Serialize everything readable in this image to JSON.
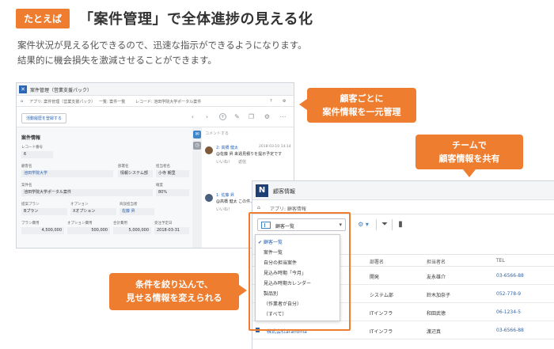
{
  "header": {
    "tag": "たとえば",
    "title": "「案件管理」で全体進捗の見える化",
    "desc_line1": "案件状況が見える化できるので、迅速な指示ができるようになります。",
    "desc_line2": "結果的に機会損失を激減させることができます。"
  },
  "callouts": {
    "c1_line1": "顧客ごとに",
    "c1_line2": "案件情報を一元管理",
    "c2_line1": "チームで",
    "c2_line2": "顧客情報を共有",
    "c3_line1": "条件を絞り込んで、",
    "c3_line2": "見せる情報を変えられる"
  },
  "shot1": {
    "app_title": "案件管理（営業支援パック）",
    "crumb_app": "アプリ: 案件管理（営業支援パック）",
    "crumb_list": "一覧: 案件一覧",
    "crumb_record": "レコード: 池田学院大学ポータル案件",
    "button_activity": "活動履歴を登録する",
    "form_title": "案件情報",
    "labels": {
      "record_no": "レコード番号",
      "customer": "顧客名",
      "dept": "部署名",
      "owner": "担当者名",
      "deal": "案件名",
      "prob": "確度",
      "plan": "提案プラン",
      "option": "オプション",
      "sales": "商談担当者",
      "plan_fee": "プラン費用",
      "option_fee": "オプション費用",
      "total": "合計費用",
      "order_date": "受注予定日"
    },
    "values": {
      "record_no": "6",
      "customer": "池田学院大学",
      "dept": "情報システム部",
      "owner": "小寺 朝里",
      "deal": "池田学院大学ポータル案件",
      "prob": "80%",
      "plan": "Bプラン",
      "option": "Xオプション",
      "sales": "佐藤 昇",
      "plan_fee": "4,500,000",
      "option_fee": "500,000",
      "total": "5,000,000",
      "order_date": "2018-03-31"
    },
    "comments": {
      "placeholder": "コメントする",
      "c1_author": "2: 高橋 健太",
      "c1_date": "2018-03-10 14:14",
      "c1_text": "@佐藤 昇 来週見積りを提示予定です",
      "c1_like": "いいね！",
      "c1_reply": "返信",
      "c2_author": "1: 佐藤 昇",
      "c2_text": "@高橋 健太 この件、",
      "c2_like": "いいね！"
    }
  },
  "shot2": {
    "app_title": "顧客情報",
    "crumb_app": "アプリ: 顧客情報",
    "view_select": "顧客一覧",
    "dropdown": [
      "顧客一覧",
      "案件一覧",
      "自分の担当案件",
      "見込み時期「今月」",
      "見込み時期カレンダー",
      "製品別",
      "（作業者が自分）",
      "（すべて）"
    ],
    "columns": [
      "部署名",
      "担当者名",
      "TEL"
    ],
    "rows": [
      {
        "dept": "開発",
        "person": "友永雄介",
        "tel": "03-6566-88"
      },
      {
        "dept": "システム部",
        "person": "鈴木加奈子",
        "tel": "052-778-9"
      },
      {
        "dept": "ITインフラ",
        "person": "和田武徳",
        "tel": "06-1234-5"
      },
      {
        "dept": "ITインフラ",
        "person": "渡辺真",
        "tel": "03-6566-88"
      }
    ],
    "partial_company": "株式会社arahoma"
  }
}
